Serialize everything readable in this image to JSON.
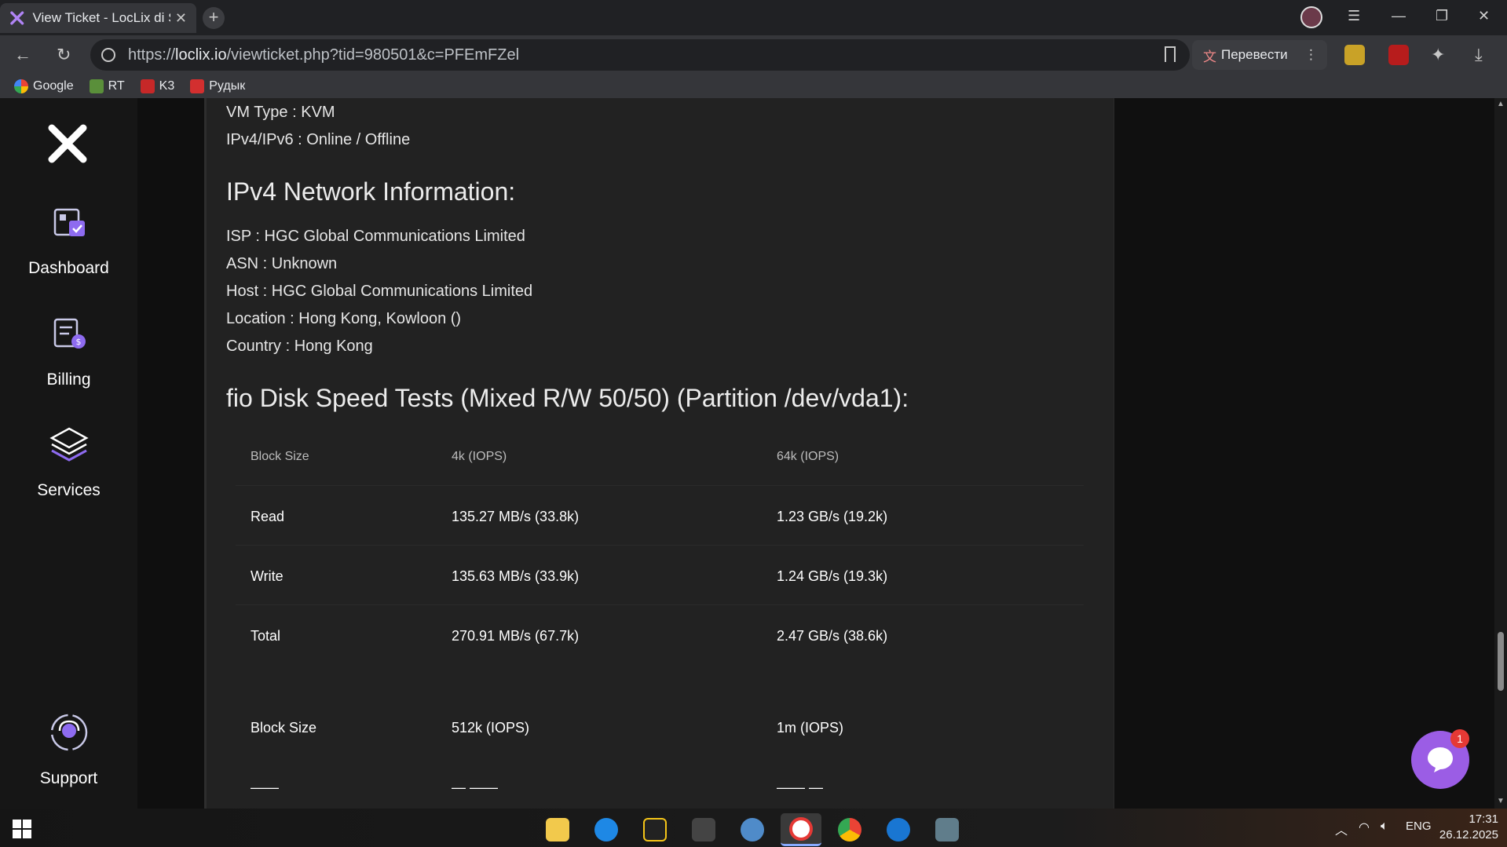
{
  "browser": {
    "tab_title": "View Ticket - LocLix di S",
    "url_prefix": "https://",
    "url_domain": "loclix.io",
    "url_path": "/viewticket.php?tid=980501&c=PFEmFZel",
    "translate_label": "Перевести",
    "bookmarks": [
      "Google",
      "RT",
      "K3",
      "Рудык"
    ]
  },
  "sidebar": {
    "items": [
      {
        "label": "Dashboard",
        "icon": "dashboard-icon"
      },
      {
        "label": "Billing",
        "icon": "billing-icon"
      },
      {
        "label": "Services",
        "icon": "services-icon"
      },
      {
        "label": "Support",
        "icon": "support-icon"
      }
    ]
  },
  "ticket": {
    "lines_top": [
      "VM Type : KVM",
      "IPv4/IPv6 : Online / Offline"
    ],
    "network_heading": "IPv4 Network Information:",
    "network_lines": [
      "ISP : HGC Global Communications Limited",
      "ASN : Unknown",
      "Host : HGC Global Communications Limited",
      "Location : Hong Kong, Kowloon ()",
      "Country : Hong Kong"
    ],
    "fio_heading": "fio Disk Speed Tests (Mixed R/W 50/50) (Partition /dev/vda1):",
    "table1": {
      "header": [
        "Block Size",
        "4k (IOPS)",
        "64k (IOPS)"
      ],
      "rows": [
        [
          "Read",
          "135.27 MB/s (33.8k)",
          "1.23 GB/s (19.2k)"
        ],
        [
          "Write",
          "135.63 MB/s (33.9k)",
          "1.24 GB/s (19.3k)"
        ],
        [
          "Total",
          "270.91 MB/s (67.7k)",
          "2.47 GB/s (38.6k)"
        ]
      ]
    },
    "table2": {
      "header": [
        "Block Size",
        "512k (IOPS)",
        "1m (IOPS)"
      ],
      "rows": [
        [
          "——",
          "— ——",
          "—— —"
        ]
      ]
    }
  },
  "chat": {
    "badge": "1"
  },
  "taskbar": {
    "lang": "ENG",
    "time": "17:31",
    "date": "26.12.2025"
  }
}
